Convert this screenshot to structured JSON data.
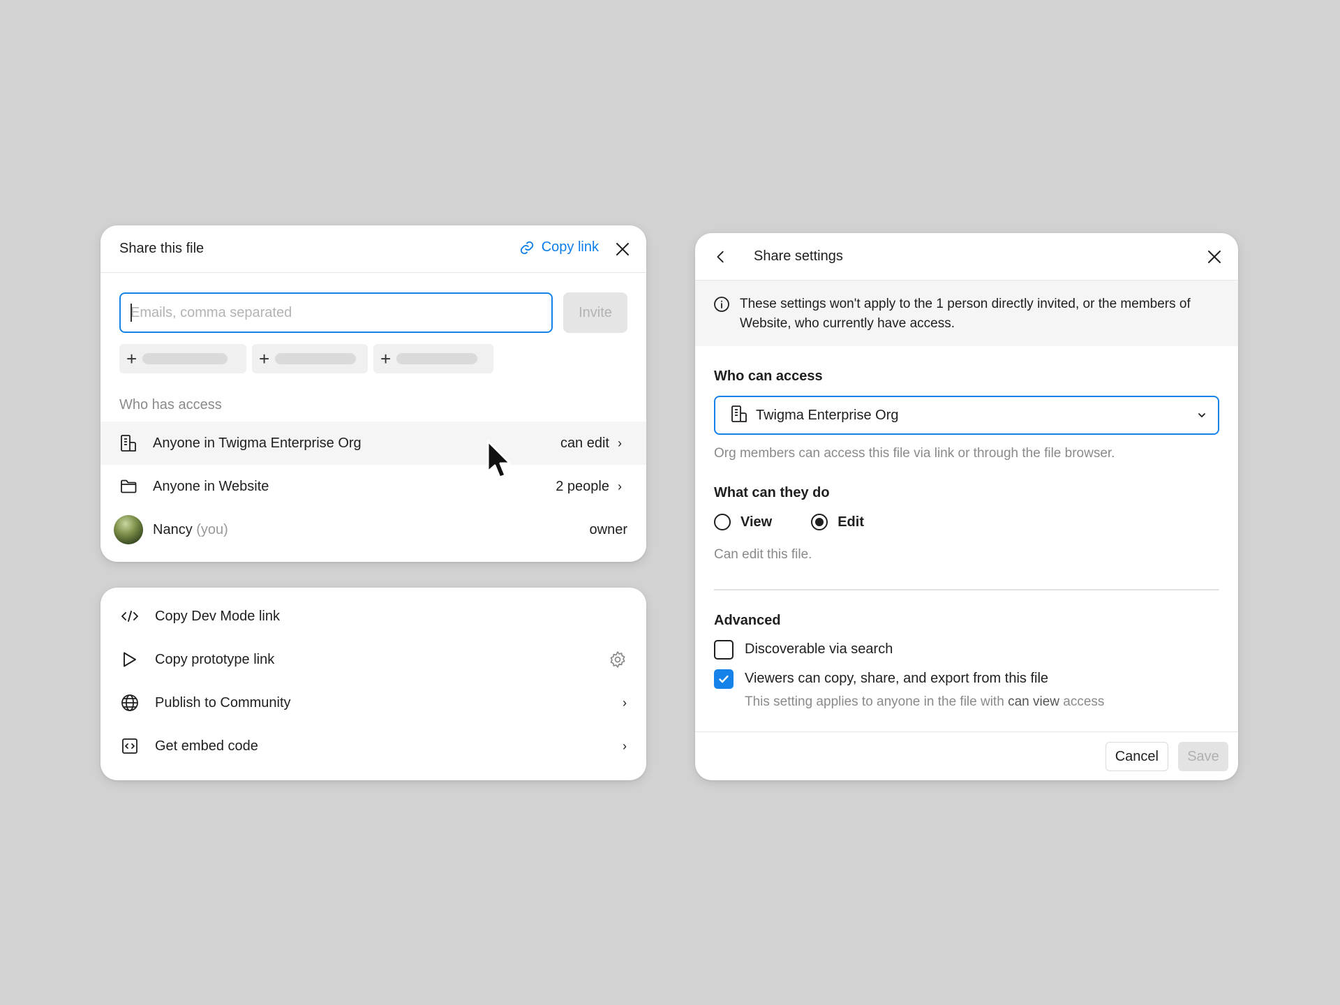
{
  "share_panel": {
    "title": "Share this file",
    "copy_link_label": "Copy link",
    "email_placeholder": "Emails, comma separated",
    "invite_label": "Invite",
    "who_has_access_label": "Who has access",
    "access_rows": [
      {
        "label": "Anyone in Twigma Enterprise Org",
        "value": "can edit",
        "icon": "org-building-icon"
      },
      {
        "label": "Anyone in Website",
        "value": "2 people",
        "icon": "folder-icon"
      },
      {
        "name": "Nancy",
        "suffix": "(you)",
        "value": "owner",
        "icon": "avatar"
      }
    ]
  },
  "options_panel": {
    "items": [
      {
        "label": "Copy Dev Mode link",
        "icon": "code-icon"
      },
      {
        "label": "Copy prototype link",
        "icon": "play-icon",
        "trailing": "gear-icon"
      },
      {
        "label": "Publish to Community",
        "icon": "globe-icon",
        "trailing": "chevron-right-icon"
      },
      {
        "label": "Get embed code",
        "icon": "embed-icon",
        "trailing": "chevron-right-icon"
      }
    ]
  },
  "settings_panel": {
    "title": "Share settings",
    "info_text": "These settings won't apply to the 1 person directly invited, or the members of Website, who currently have access.",
    "who_can_access_label": "Who can access",
    "access_selection": "Twigma Enterprise Org",
    "access_helper": "Org members can access this file via link or through the file browser.",
    "what_can_they_do_label": "What can they do",
    "permission_options": [
      "View",
      "Edit"
    ],
    "selected_permission": "Edit",
    "permission_helper": "Can edit this file.",
    "advanced_label": "Advanced",
    "discoverable_label": "Discoverable via search",
    "discoverable_checked": false,
    "viewers_copy_label": "Viewers can copy, share, and export from this file",
    "viewers_copy_checked": true,
    "viewers_note_prefix": "This setting applies to anyone in the file with",
    "viewers_note_bold": "can view",
    "viewers_note_suffix": "access",
    "cancel_label": "Cancel",
    "save_label": "Save"
  },
  "colors": {
    "background": "#d2d2d2",
    "accent_blue": "#0d7ee8",
    "panel": "#ffffff",
    "muted_text": "#8a8a8a"
  }
}
